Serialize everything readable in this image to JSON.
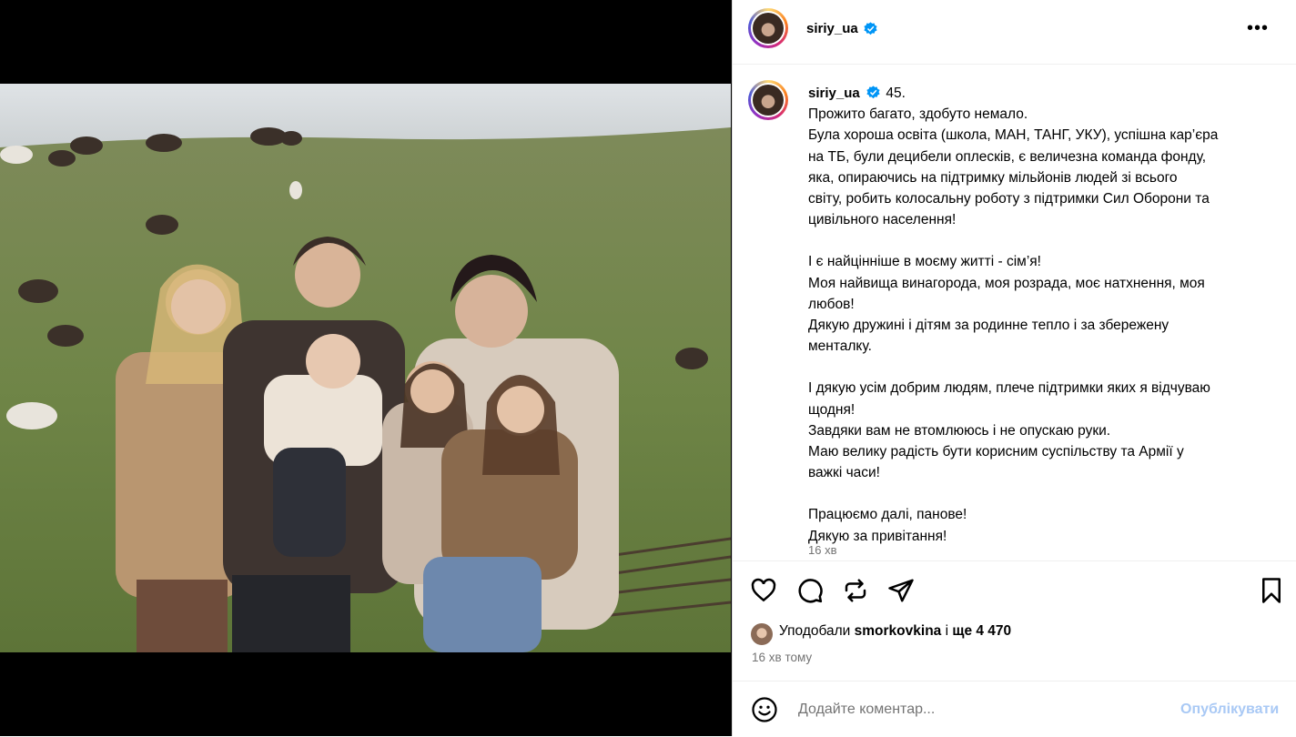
{
  "post": {
    "username": "siriy_ua",
    "verified_color": "#0095f6",
    "more_label": "•••",
    "caption_lead": "45.",
    "caption_lines": [
      "Прожито багато, здобуто немало.",
      "Була хороша освіта (школа, МАН, ТАНГ, УКУ), успішна кар’єра",
      "на ТБ, були децибели оплесків, є величезна команда фонду,",
      "яка, опираючись на підтримку мільйонів людей зі всього",
      "світу, робить колосальну роботу з підтримки Сил Оборони та",
      "цивільного населення!",
      "",
      "І є найцінніше в моєму житті - сім’я!",
      "Моя найвища винагорода, моя розрада, моє натхнення, моя",
      "любов!",
      "Дякую дружині і дітям за родинне тепло і за збережену",
      "менталку.",
      "",
      "І дякую усім добрим людям, плече підтримки яких я відчуваю",
      "щодня!",
      "Завдяки вам не втомлююсь і не опускаю руки.",
      "Маю велику радість бути корисним суспільству та Армії у",
      "важкі часи!",
      "",
      "Працюємо далі, панове!",
      "Дякую за привітання!"
    ],
    "caption_time": "16 хв",
    "likes_prefix": "Уподобали",
    "likes_user": "smorkovkina",
    "likes_mid": "і",
    "likes_more": "ще 4 470",
    "time_ago": "16 хв тому",
    "comment_placeholder": "Додайте коментар...",
    "post_button": "Опублікувати",
    "icons": [
      "heart-icon",
      "comment-icon",
      "repost-icon",
      "share-icon",
      "bookmark-icon",
      "emoji-icon"
    ]
  }
}
